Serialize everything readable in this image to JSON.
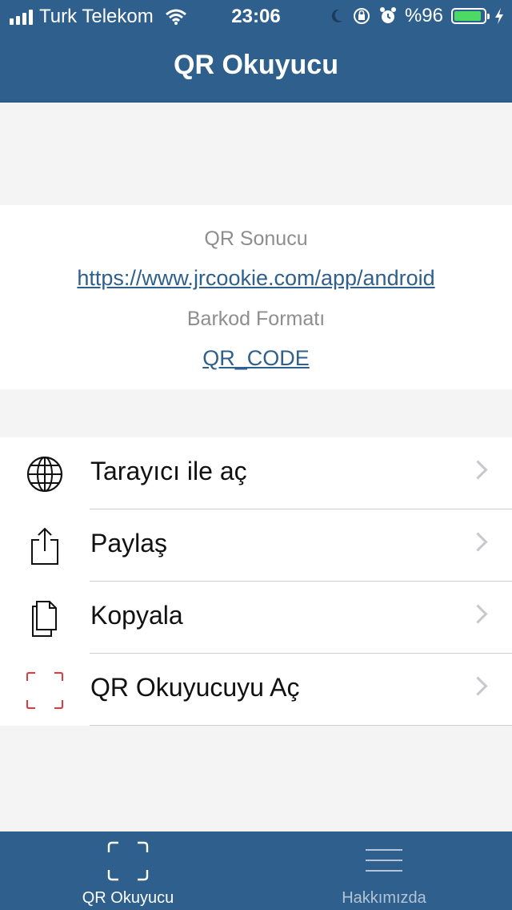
{
  "status_bar": {
    "carrier": "Turk Telekom",
    "time": "23:06",
    "battery": "%96"
  },
  "nav": {
    "title": "QR Okuyucu"
  },
  "result": {
    "qr_label": "QR Sonucu",
    "qr_value": "https://www.jrcookie.com/app/android",
    "format_label": "Barkod Formatı",
    "format_value": "QR_CODE"
  },
  "actions": [
    {
      "label": "Tarayıcı ile aç",
      "icon": "globe-icon"
    },
    {
      "label": "Paylaş",
      "icon": "share-icon"
    },
    {
      "label": "Kopyala",
      "icon": "copy-icon"
    },
    {
      "label": "QR Okuyucuyu Aç",
      "icon": "scan-frame-icon"
    }
  ],
  "tabs": [
    {
      "label": "QR Okuyucu",
      "icon": "scan-frame-icon",
      "active": true
    },
    {
      "label": "Hakkımızda",
      "icon": "menu-icon",
      "active": false
    }
  ],
  "colors": {
    "primary": "#2f5f8c",
    "link": "#2f5f8c",
    "scan_accent": "#e0393e",
    "battery": "#4cd964"
  }
}
